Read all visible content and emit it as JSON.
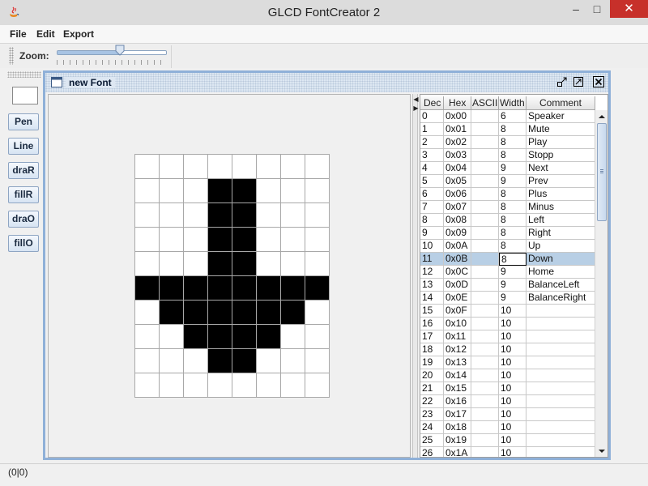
{
  "window": {
    "title": "GLCD FontCreator 2",
    "minimize_glyph": "–",
    "maximize_glyph": "□",
    "close_glyph": "✕"
  },
  "menu": [
    {
      "label": "File"
    },
    {
      "label": "Edit"
    },
    {
      "label": "Export"
    }
  ],
  "toolbar": {
    "zoom_label": "Zoom:",
    "zoom_level": 0.58
  },
  "tools": {
    "color_swatch": "#ffffff",
    "buttons": [
      {
        "label": "Pen"
      },
      {
        "label": "Line"
      },
      {
        "label": "draR"
      },
      {
        "label": "fillR"
      },
      {
        "label": "draO"
      },
      {
        "label": "fillO"
      }
    ]
  },
  "editor": {
    "title": "new Font"
  },
  "glyph": {
    "columns": 8,
    "rows": [
      [
        0,
        0,
        0,
        0,
        0,
        0,
        0,
        0
      ],
      [
        0,
        0,
        0,
        1,
        1,
        0,
        0,
        0
      ],
      [
        0,
        0,
        0,
        1,
        1,
        0,
        0,
        0
      ],
      [
        0,
        0,
        0,
        1,
        1,
        0,
        0,
        0
      ],
      [
        0,
        0,
        0,
        1,
        1,
        0,
        0,
        0
      ],
      [
        1,
        1,
        1,
        1,
        1,
        1,
        1,
        1
      ],
      [
        0,
        1,
        1,
        1,
        1,
        1,
        1,
        0
      ],
      [
        0,
        0,
        1,
        1,
        1,
        1,
        0,
        0
      ],
      [
        0,
        0,
        0,
        1,
        1,
        0,
        0,
        0
      ],
      [
        0,
        0,
        0,
        0,
        0,
        0,
        0,
        0
      ]
    ]
  },
  "table": {
    "headers": [
      {
        "label": "Dec"
      },
      {
        "label": "Hex"
      },
      {
        "label": "ASCII"
      },
      {
        "label": "Width"
      },
      {
        "label": "Comment"
      }
    ],
    "selected_row": 11,
    "rows": [
      [
        "0",
        "0x00",
        "",
        "6",
        "Speaker"
      ],
      [
        "1",
        "0x01",
        "",
        "8",
        "Mute"
      ],
      [
        "2",
        "0x02",
        "",
        "8",
        "Play"
      ],
      [
        "3",
        "0x03",
        "",
        "8",
        "Stopp"
      ],
      [
        "4",
        "0x04",
        "",
        "9",
        "Next"
      ],
      [
        "5",
        "0x05",
        "",
        "9",
        "Prev"
      ],
      [
        "6",
        "0x06",
        "",
        "8",
        "Plus"
      ],
      [
        "7",
        "0x07",
        "",
        "8",
        "Minus"
      ],
      [
        "8",
        "0x08",
        "",
        "8",
        "Left"
      ],
      [
        "9",
        "0x09",
        "",
        "8",
        "Right"
      ],
      [
        "10",
        "0x0A",
        "",
        "8",
        "Up"
      ],
      [
        "11",
        "0x0B",
        "",
        "8",
        "Down"
      ],
      [
        "12",
        "0x0C",
        "",
        "9",
        "Home"
      ],
      [
        "13",
        "0x0D",
        "",
        "9",
        "BalanceLeft"
      ],
      [
        "14",
        "0x0E",
        "",
        "9",
        "BalanceRight"
      ],
      [
        "15",
        "0x0F",
        "",
        "10",
        ""
      ],
      [
        "16",
        "0x10",
        "",
        "10",
        ""
      ],
      [
        "17",
        "0x11",
        "",
        "10",
        ""
      ],
      [
        "18",
        "0x12",
        "",
        "10",
        ""
      ],
      [
        "19",
        "0x13",
        "",
        "10",
        ""
      ],
      [
        "20",
        "0x14",
        "",
        "10",
        ""
      ],
      [
        "21",
        "0x15",
        "",
        "10",
        ""
      ],
      [
        "22",
        "0x16",
        "",
        "10",
        ""
      ],
      [
        "23",
        "0x17",
        "",
        "10",
        ""
      ],
      [
        "24",
        "0x18",
        "",
        "10",
        ""
      ],
      [
        "25",
        "0x19",
        "",
        "10",
        ""
      ],
      [
        "26",
        "0x1A",
        "",
        "10",
        ""
      ]
    ]
  },
  "status": {
    "text": "(0|0)"
  }
}
